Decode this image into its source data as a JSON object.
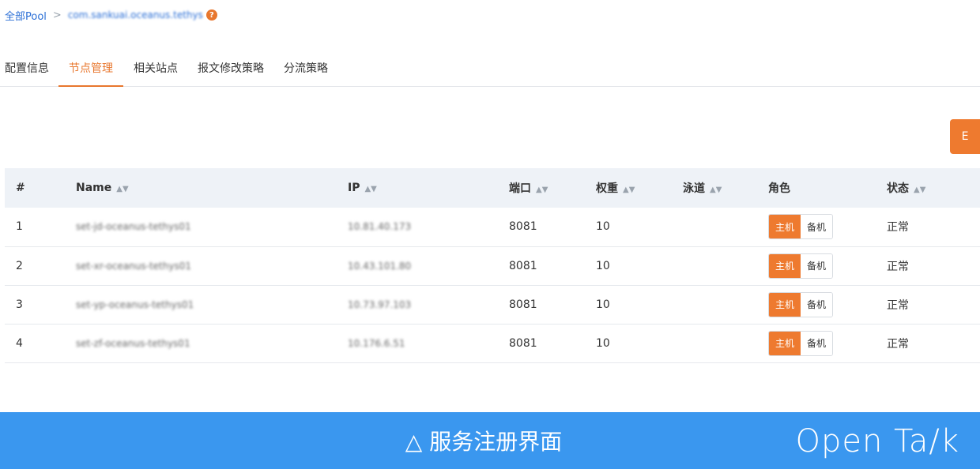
{
  "breadcrumb": {
    "root": "全部Pool",
    "separator": ">",
    "current": "com.sankuai.oceanus.tethys",
    "help_icon": "?"
  },
  "tabs": [
    {
      "label": "配置信息",
      "active": false
    },
    {
      "label": "节点管理",
      "active": true
    },
    {
      "label": "相关站点",
      "active": false
    },
    {
      "label": "报文修改策略",
      "active": false
    },
    {
      "label": "分流策略",
      "active": false
    }
  ],
  "action_button": {
    "label": "E"
  },
  "table": {
    "columns": [
      "#",
      "Name",
      "IP",
      "端口",
      "权重",
      "泳道",
      "角色",
      "状态"
    ],
    "sort_icon": "▲▼",
    "rows": [
      {
        "index": "1",
        "name": "set-jd-oceanus-tethys01",
        "ip": "10.81.40.173",
        "port": "8081",
        "weight": "10",
        "lane": "",
        "role_primary": "主机",
        "role_backup": "备机",
        "status": "正常"
      },
      {
        "index": "2",
        "name": "set-xr-oceanus-tethys01",
        "ip": "10.43.101.80",
        "port": "8081",
        "weight": "10",
        "lane": "",
        "role_primary": "主机",
        "role_backup": "备机",
        "status": "正常"
      },
      {
        "index": "3",
        "name": "set-yp-oceanus-tethys01",
        "ip": "10.73.97.103",
        "port": "8081",
        "weight": "10",
        "lane": "",
        "role_primary": "主机",
        "role_backup": "备机",
        "status": "正常"
      },
      {
        "index": "4",
        "name": "set-zf-oceanus-tethys01",
        "ip": "10.176.6.51",
        "port": "8081",
        "weight": "10",
        "lane": "",
        "role_primary": "主机",
        "role_backup": "备机",
        "status": "正常"
      }
    ]
  },
  "banner": {
    "caption": "△ 服务注册界面",
    "logo": "Open Ta/k"
  },
  "colors": {
    "accent": "#ee7a2f",
    "link": "#2b6fd6",
    "status_normal": "#52a43a",
    "banner": "#3a97ef",
    "table_header": "#eef2f7"
  }
}
